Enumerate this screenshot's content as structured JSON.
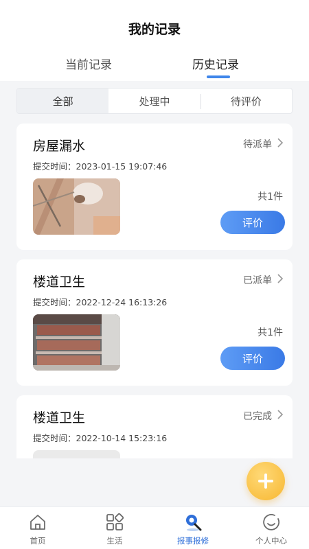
{
  "header": {
    "title": "我的记录",
    "tabs": [
      {
        "label": "当前记录",
        "active": false
      },
      {
        "label": "历史记录",
        "active": true
      }
    ]
  },
  "filter": {
    "options": [
      "全部",
      "处理中",
      "待评价"
    ],
    "selected": "全部"
  },
  "records": [
    {
      "name": "房屋漏水",
      "status": "待派单",
      "time": "提交时间：2023-01-15 19:07:46",
      "count": "共1件",
      "button": "评价"
    },
    {
      "name": "楼道卫生",
      "status": "已派单",
      "time": "提交时间：2022-12-24 16:13:26",
      "count": "共1件",
      "button": "评价"
    },
    {
      "name": "楼道卫生",
      "status": "已完成",
      "time": "提交时间：2022-10-14 15:23:16"
    }
  ],
  "tabbar": {
    "items": [
      {
        "label": "首页",
        "icon": "home-icon",
        "active": false
      },
      {
        "label": "生活",
        "icon": "grid-icon",
        "active": false
      },
      {
        "label": "报事报修",
        "icon": "repair-icon",
        "active": true
      },
      {
        "label": "个人中心",
        "icon": "profile-icon",
        "active": false
      }
    ]
  },
  "colors": {
    "accent": "#3f86ea",
    "fab": "#f7b731",
    "background": "#f4f5f7"
  }
}
